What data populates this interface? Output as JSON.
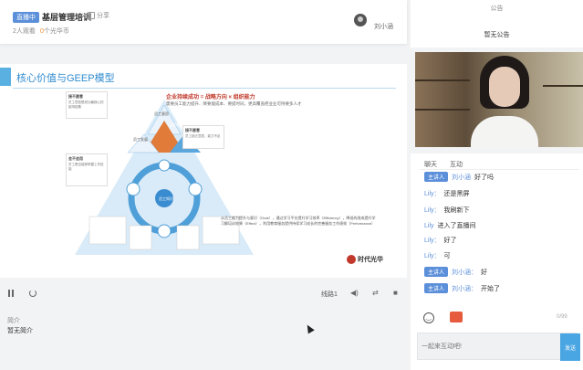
{
  "header": {
    "live_badge": "直播中",
    "title": "基层管理培训",
    "share_label": "分享",
    "viewers": "2人观看",
    "coins_num": "0",
    "coins_label": "个光华币",
    "host_name": "刘小涵"
  },
  "slide": {
    "title": "核心价值与GEEP模型",
    "headline": "企业持续成功 = 战略方向 × 组织能力",
    "subline": "需要员工能力提升、降要能成本、要提时间，更高覆盖把业业可持要多人才",
    "right_para": "从员工能力提升与意识（Goal），通过学习平台提升学习效率（Efficiency），降低的改成提升学习解培训效果（Effect），利用教育服务提供持续学习成长的完善服务工作绩效（Performance）",
    "logo_text": "时代光华",
    "pyramid_labels": [
      "员工意愿",
      "员工发展",
      "组织能力",
      "员工能力",
      "员工知识"
    ],
    "callouts": [
      {
        "title": "接不愿意",
        "text": "员工意愿是成功最核心的影响因素"
      },
      {
        "title": "接不愿意",
        "text": "员工缺乏意愿，能力不足"
      },
      {
        "title": "会不会用",
        "text": "员工是否能够掌握工作技能"
      }
    ]
  },
  "controls": {
    "line_label": "线路1"
  },
  "intro": {
    "label": "简介",
    "text": "暂无简介"
  },
  "notice": {
    "title": "公告",
    "text": "暂无公告"
  },
  "chat": {
    "tabs": [
      "聊天",
      "互动"
    ],
    "messages": [
      {
        "who": "刘小涵",
        "tag": "主讲人",
        "text": "好了吗"
      },
      {
        "who": "Lily：",
        "tag": "",
        "text": "还是黑屏"
      },
      {
        "who": "Lily：",
        "tag": "",
        "text": "我刷新下"
      },
      {
        "who": "Lily",
        "tag": "",
        "text": "进入了直播间"
      },
      {
        "who": "Lily：",
        "tag": "",
        "text": "好了"
      },
      {
        "who": "Lily：",
        "tag": "",
        "text": "可"
      },
      {
        "who": "刘小涵：",
        "tag": "主讲人",
        "text": "好"
      },
      {
        "who": "刘小涵：",
        "tag": "主讲人",
        "text": "开始了"
      }
    ],
    "counter": "0/99",
    "input_placeholder": "一起来互动吧!",
    "send_label": "发送"
  },
  "colors": {
    "accent": "#5b8fd9",
    "send": "#4aa5e3",
    "slide_title": "#2f8bd0",
    "headline_red": "#c0392b"
  }
}
